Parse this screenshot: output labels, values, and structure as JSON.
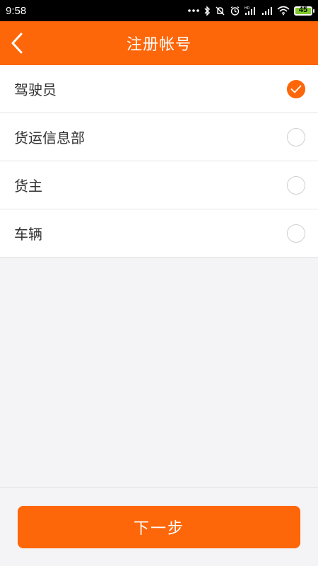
{
  "status_bar": {
    "time": "9:58",
    "battery_level": "45",
    "icons": [
      "more-dots-icon",
      "bluetooth-icon",
      "silent-icon",
      "alarm-icon",
      "signal-hd-icon",
      "signal-icon",
      "wifi-icon",
      "battery-icon"
    ]
  },
  "header": {
    "title": "注册帐号",
    "back_icon": "chevron-left-icon"
  },
  "options": [
    {
      "label": "驾驶员",
      "selected": true
    },
    {
      "label": "货运信息部",
      "selected": false
    },
    {
      "label": "货主",
      "selected": false
    },
    {
      "label": "车辆",
      "selected": false
    }
  ],
  "footer": {
    "next_label": "下一步"
  },
  "colors": {
    "accent": "#fd670a",
    "background": "#f4f3f5",
    "text": "#333333"
  }
}
